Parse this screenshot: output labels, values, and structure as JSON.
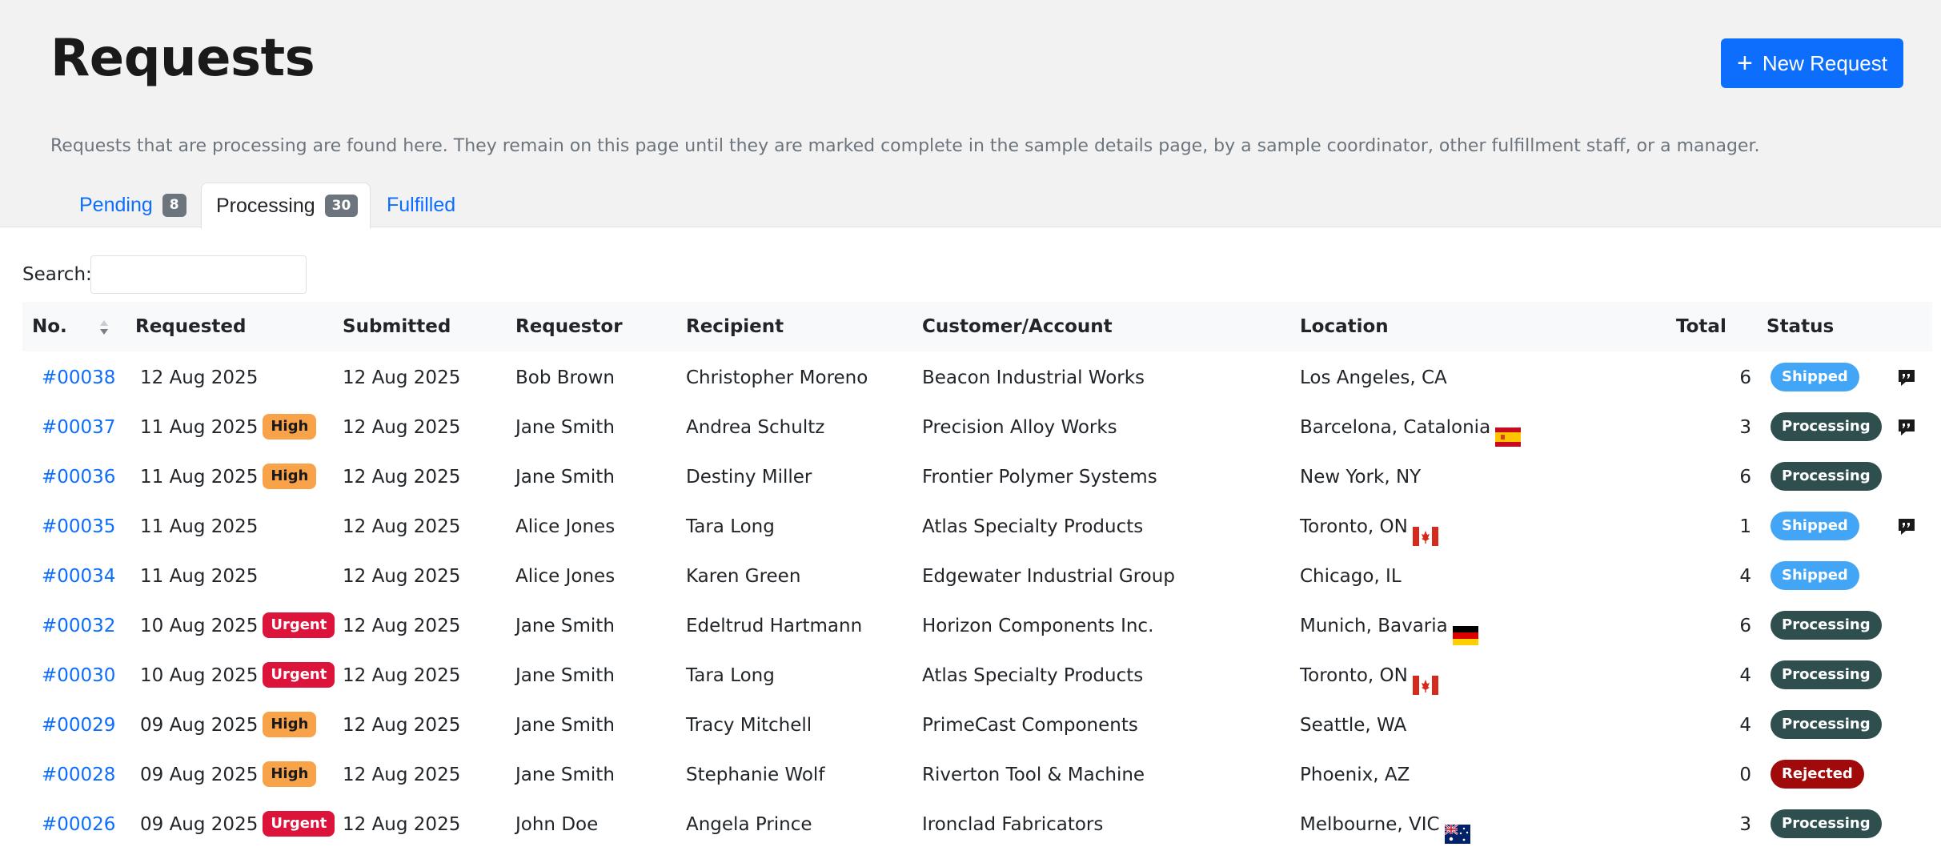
{
  "header": {
    "title": "Requests",
    "new_request_label": "New Request",
    "intro": "Requests that are processing are found here. They remain on this page until they are marked complete in the sample details page, by a sample coordinator, other fulfillment staff, or a manager."
  },
  "tabs": [
    {
      "label": "Pending",
      "count": "8"
    },
    {
      "label": "Processing",
      "count": "30"
    },
    {
      "label": "Fulfilled"
    }
  ],
  "search": {
    "label": "Search:",
    "value": ""
  },
  "table": {
    "columns": [
      "No.",
      "Requested",
      "Submitted",
      "Requestor",
      "Recipient",
      "Customer/Account",
      "Location",
      "Total",
      "Status"
    ],
    "rows": [
      {
        "no": "#00038",
        "requested": "12 Aug 2025",
        "priority": "",
        "submitted": "12 Aug 2025",
        "requestor": "Bob Brown",
        "recipient": "Christopher Moreno",
        "customer": "Beacon Industrial Works",
        "location": "Los Angeles, CA",
        "flag": "",
        "total": "6",
        "status": "Shipped",
        "comment": true
      },
      {
        "no": "#00037",
        "requested": "11 Aug 2025",
        "priority": "High",
        "submitted": "12 Aug 2025",
        "requestor": "Jane Smith",
        "recipient": "Andrea Schultz",
        "customer": "Precision Alloy Works",
        "location": "Barcelona, Catalonia",
        "flag": "es-flag-icon",
        "total": "3",
        "status": "Processing",
        "comment": true
      },
      {
        "no": "#00036",
        "requested": "11 Aug 2025",
        "priority": "High",
        "submitted": "12 Aug 2025",
        "requestor": "Jane Smith",
        "recipient": "Destiny Miller",
        "customer": "Frontier Polymer Systems",
        "location": "New York, NY",
        "flag": "",
        "total": "6",
        "status": "Processing",
        "comment": false
      },
      {
        "no": "#00035",
        "requested": "11 Aug 2025",
        "priority": "",
        "submitted": "12 Aug 2025",
        "requestor": "Alice Jones",
        "recipient": "Tara Long",
        "customer": "Atlas Specialty Products",
        "location": "Toronto, ON",
        "flag": "ca-flag-icon",
        "total": "1",
        "status": "Shipped",
        "comment": true
      },
      {
        "no": "#00034",
        "requested": "11 Aug 2025",
        "priority": "",
        "submitted": "12 Aug 2025",
        "requestor": "Alice Jones",
        "recipient": "Karen Green",
        "customer": "Edgewater Industrial Group",
        "location": "Chicago, IL",
        "flag": "",
        "total": "4",
        "status": "Shipped",
        "comment": false
      },
      {
        "no": "#00032",
        "requested": "10 Aug 2025",
        "priority": "Urgent",
        "submitted": "12 Aug 2025",
        "requestor": "Jane Smith",
        "recipient": "Edeltrud Hartmann",
        "customer": "Horizon Components Inc.",
        "location": "Munich, Bavaria",
        "flag": "de-flag-icon",
        "total": "6",
        "status": "Processing",
        "comment": false
      },
      {
        "no": "#00030",
        "requested": "10 Aug 2025",
        "priority": "Urgent",
        "submitted": "12 Aug 2025",
        "requestor": "Jane Smith",
        "recipient": "Tara Long",
        "customer": "Atlas Specialty Products",
        "location": "Toronto, ON",
        "flag": "ca-flag-icon",
        "total": "4",
        "status": "Processing",
        "comment": false
      },
      {
        "no": "#00029",
        "requested": "09 Aug 2025",
        "priority": "High",
        "submitted": "12 Aug 2025",
        "requestor": "Jane Smith",
        "recipient": "Tracy Mitchell",
        "customer": "PrimeCast Components",
        "location": "Seattle, WA",
        "flag": "",
        "total": "4",
        "status": "Processing",
        "comment": false
      },
      {
        "no": "#00028",
        "requested": "09 Aug 2025",
        "priority": "High",
        "submitted": "12 Aug 2025",
        "requestor": "Jane Smith",
        "recipient": "Stephanie Wolf",
        "customer": "Riverton Tool & Machine",
        "location": "Phoenix, AZ",
        "flag": "",
        "total": "0",
        "status": "Rejected",
        "comment": false
      },
      {
        "no": "#00026",
        "requested": "09 Aug 2025",
        "priority": "Urgent",
        "submitted": "12 Aug 2025",
        "requestor": "John Doe",
        "recipient": "Angela Prince",
        "customer": "Ironclad Fabricators",
        "location": "Melbourne, VIC",
        "flag": "au-flag-icon",
        "total": "3",
        "status": "Processing",
        "comment": false
      }
    ]
  },
  "colors": {
    "accent": "#0d6efd",
    "high": "#f8a34a",
    "urgent": "#dc143c",
    "shipped": "#42a5f5",
    "processing": "#2f4f4f",
    "rejected": "#a10a0a"
  }
}
